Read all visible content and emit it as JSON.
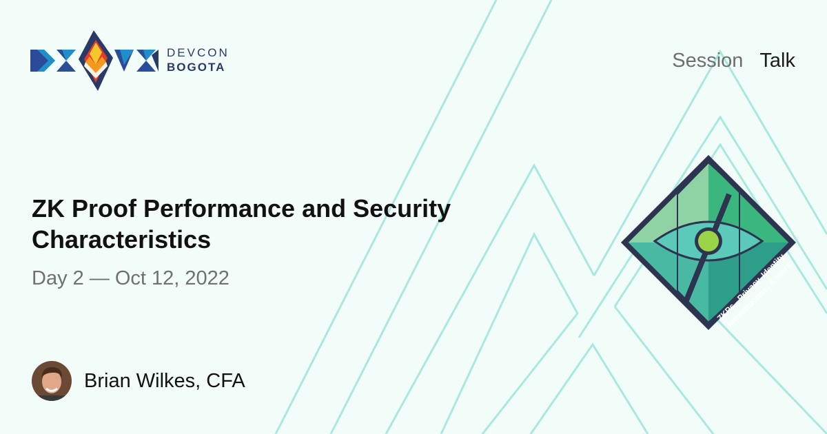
{
  "brand": {
    "line1": "DEVCON",
    "line2": "BOGOTA"
  },
  "tags": [
    {
      "label": "Session",
      "active": false
    },
    {
      "label": "Talk",
      "active": true
    }
  ],
  "session": {
    "title": "ZK Proof Performance and Security Characteristics",
    "date": "Day 2 — Oct 12, 2022"
  },
  "speaker": {
    "name": "Brian Wilkes, CFA"
  },
  "badge": {
    "label_line1": "ZKPs - Privacy, Identity,",
    "label_line2": "Infrastructure, & more"
  },
  "colors": {
    "background": "#f2fcf9",
    "line_accent": "#a8e8de",
    "logo_navy": "#2a3a66",
    "badge_green": "#3fb87e",
    "badge_frame": "#2c3450",
    "badge_eye": "#9bd448"
  }
}
